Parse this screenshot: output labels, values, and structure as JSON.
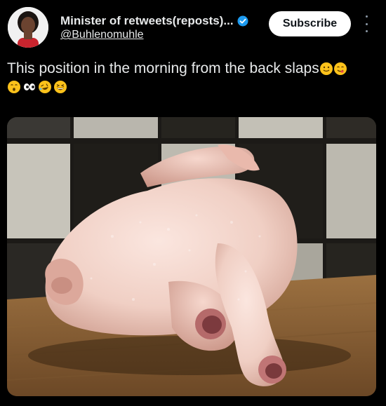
{
  "author": {
    "display_name": "Minister of retweets(reposts)...",
    "handle": "@Buhlenomuhle",
    "verified": true
  },
  "actions": {
    "subscribe_label": "Subscribe"
  },
  "tweet": {
    "text": "This position in the morning from the back slaps",
    "emoji_trailing": [
      "smiling-face-icon",
      "face-savoring-food-icon"
    ],
    "emoji_second_line": [
      "hushed-face-icon",
      "eyes-icon",
      "rolling-laughing-icon",
      "grinning-squinting-icon"
    ]
  },
  "media": {
    "description_icon": "raw-chicken-photo"
  },
  "colors": {
    "background": "#000000",
    "text": "#e7e9ea",
    "verified_blue": "#1d9bf0",
    "subscribe_bg": "#ffffff"
  }
}
